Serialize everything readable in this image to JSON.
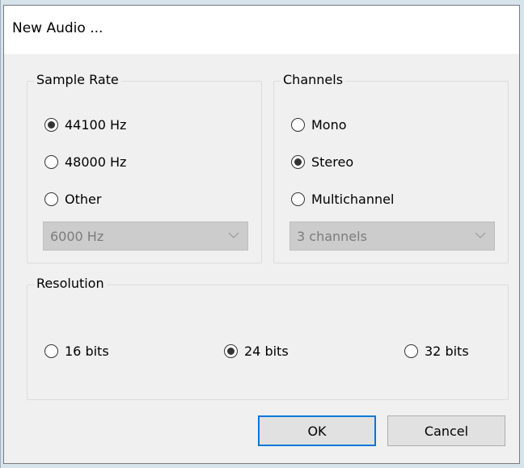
{
  "dialog": {
    "title": "New Audio ..."
  },
  "sample_rate": {
    "legend": "Sample Rate",
    "options": [
      {
        "label": "44100 Hz",
        "selected": true
      },
      {
        "label": "48000 Hz",
        "selected": false
      },
      {
        "label": "Other",
        "selected": false
      }
    ],
    "other_select": {
      "value": "6000 Hz",
      "enabled": false
    }
  },
  "channels": {
    "legend": "Channels",
    "options": [
      {
        "label": "Mono",
        "selected": false
      },
      {
        "label": "Stereo",
        "selected": true
      },
      {
        "label": "Multichannel",
        "selected": false
      }
    ],
    "multi_select": {
      "value": "3 channels",
      "enabled": false
    }
  },
  "resolution": {
    "legend": "Resolution",
    "options": [
      {
        "label": "16 bits",
        "selected": false
      },
      {
        "label": "24 bits",
        "selected": true
      },
      {
        "label": "32 bits",
        "selected": false
      }
    ]
  },
  "buttons": {
    "ok": "OK",
    "cancel": "Cancel"
  },
  "colors": {
    "default_button_border": "#0078d7",
    "dialog_bg": "#f0f0f0",
    "disabled_select_bg": "#cccccc"
  }
}
